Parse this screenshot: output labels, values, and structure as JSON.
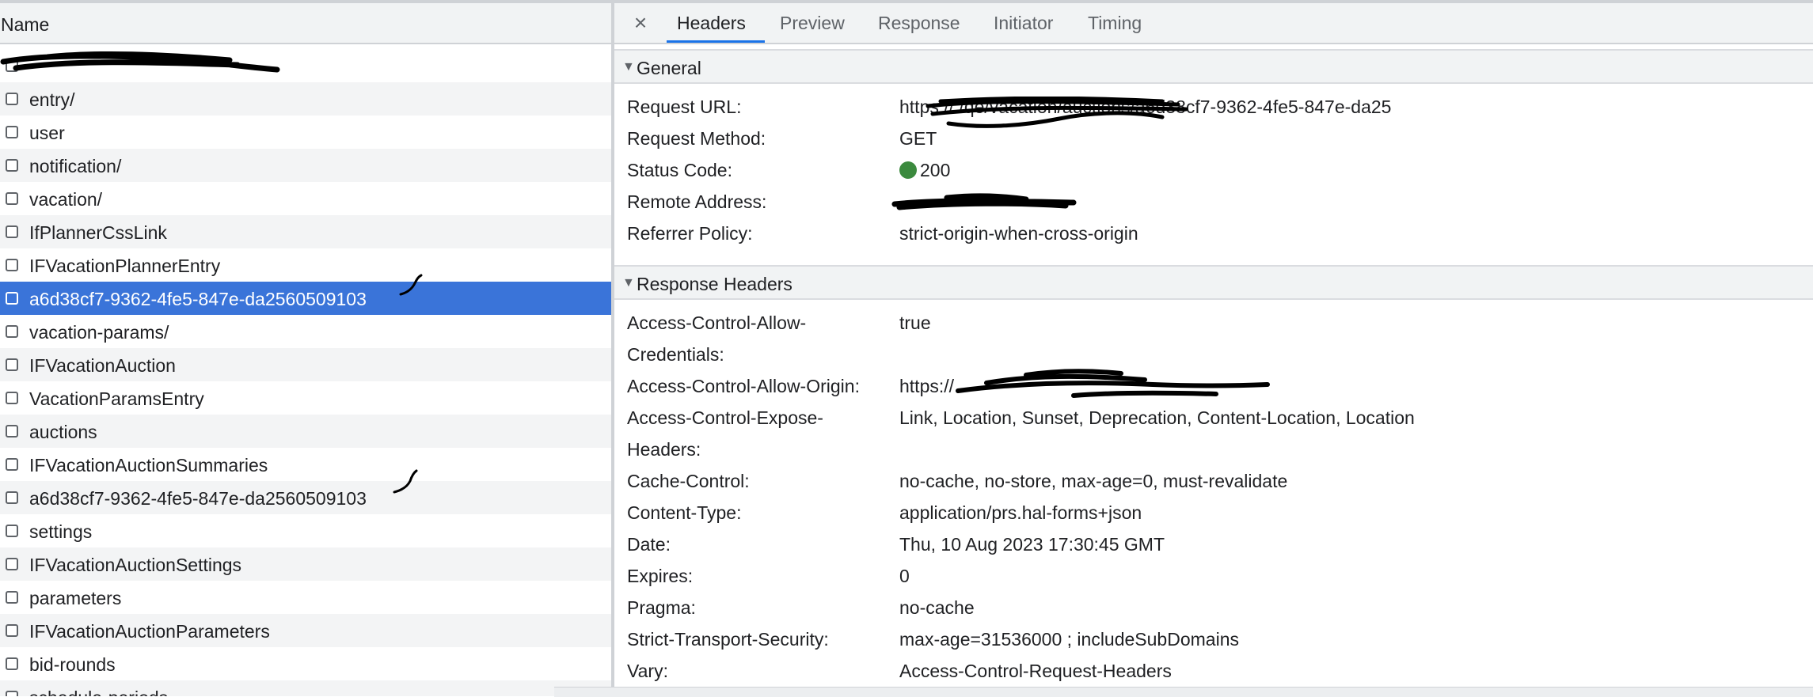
{
  "request_list": {
    "column_header": "Name",
    "items": [
      {
        "label": "",
        "redacted": true
      },
      {
        "label": "entry/"
      },
      {
        "label": "user"
      },
      {
        "label": "notification/"
      },
      {
        "label": "vacation/"
      },
      {
        "label": "IfPlannerCssLink"
      },
      {
        "label": "IFVacationPlannerEntry"
      },
      {
        "label": "a6d38cf7-9362-4fe5-847e-da2560509103",
        "selected": true
      },
      {
        "label": "vacation-params/"
      },
      {
        "label": "IFVacationAuction"
      },
      {
        "label": "VacationParamsEntry"
      },
      {
        "label": "auctions"
      },
      {
        "label": "IFVacationAuctionSummaries"
      },
      {
        "label": "a6d38cf7-9362-4fe5-847e-da2560509103"
      },
      {
        "label": "settings"
      },
      {
        "label": "IFVacationAuctionSettings"
      },
      {
        "label": "parameters"
      },
      {
        "label": "IFVacationAuctionParameters"
      },
      {
        "label": "bid-rounds"
      },
      {
        "label": "schedule-periods"
      }
    ]
  },
  "tabs": {
    "close_icon": "×",
    "items": [
      "Headers",
      "Preview",
      "Response",
      "Initiator",
      "Timing"
    ],
    "active": "Headers"
  },
  "general": {
    "title": "General",
    "request_url_label": "Request URL:",
    "request_url_value": "https://                                                      /qe/vacation/auctions/a6d38cf7-9362-4fe5-847e-da25",
    "request_method_label": "Request Method:",
    "request_method_value": "GET",
    "status_code_label": "Status Code:",
    "status_code_value": "200",
    "status_color": "#3b8a3e",
    "remote_address_label": "Remote Address:",
    "remote_address_value": "",
    "referrer_policy_label": "Referrer Policy:",
    "referrer_policy_value": "strict-origin-when-cross-origin"
  },
  "response_headers": {
    "title": "Response Headers",
    "acac_label_1": "Access-Control-Allow-",
    "acac_label_2": "Credentials:",
    "acac_value": "true",
    "acao_label": "Access-Control-Allow-Origin:",
    "acao_value": "https://",
    "aceh_label_1": "Access-Control-Expose-",
    "aceh_label_2": "Headers:",
    "aceh_value": "Link, Location, Sunset, Deprecation, Content-Location, Location",
    "cache_control_label": "Cache-Control:",
    "cache_control_value": "no-cache, no-store, max-age=0, must-revalidate",
    "content_type_label": "Content-Type:",
    "content_type_value": "application/prs.hal-forms+json",
    "date_label": "Date:",
    "date_value": "Thu, 10 Aug 2023 17:30:45 GMT",
    "expires_label": "Expires:",
    "expires_value": "0",
    "pragma_label": "Pragma:",
    "pragma_value": "no-cache",
    "sts_label": "Strict-Transport-Security:",
    "sts_value": "max-age=31536000 ; includeSubDomains",
    "vary_label": "Vary:",
    "vary_value": "Access-Control-Request-Headers"
  },
  "colors": {
    "selected_row": "#3a74d9",
    "active_tab_underline": "#1a73e8",
    "header_bg": "#f1f3f4"
  }
}
